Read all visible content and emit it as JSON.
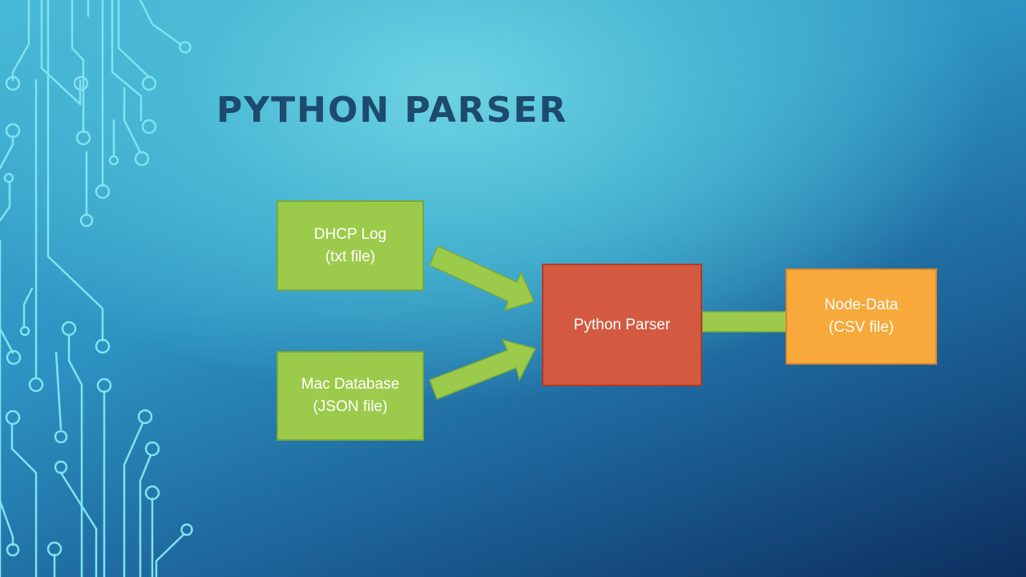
{
  "title": "PYTHON PARSER",
  "diagram": {
    "inputs": [
      {
        "line1": "DHCP Log",
        "line2": "(txt file)"
      },
      {
        "line1": "Mac Database",
        "line2": "(JSON file)"
      }
    ],
    "processor": {
      "label": "Python Parser"
    },
    "output": {
      "line1": "Node-Data",
      "line2": "(CSV file)"
    }
  },
  "colors": {
    "input_box": "#9ccb4c",
    "processor_box": "#d35a40",
    "output_box": "#f7a93b",
    "arrow": "#9ccb4c",
    "title": "#1d4a6e"
  }
}
